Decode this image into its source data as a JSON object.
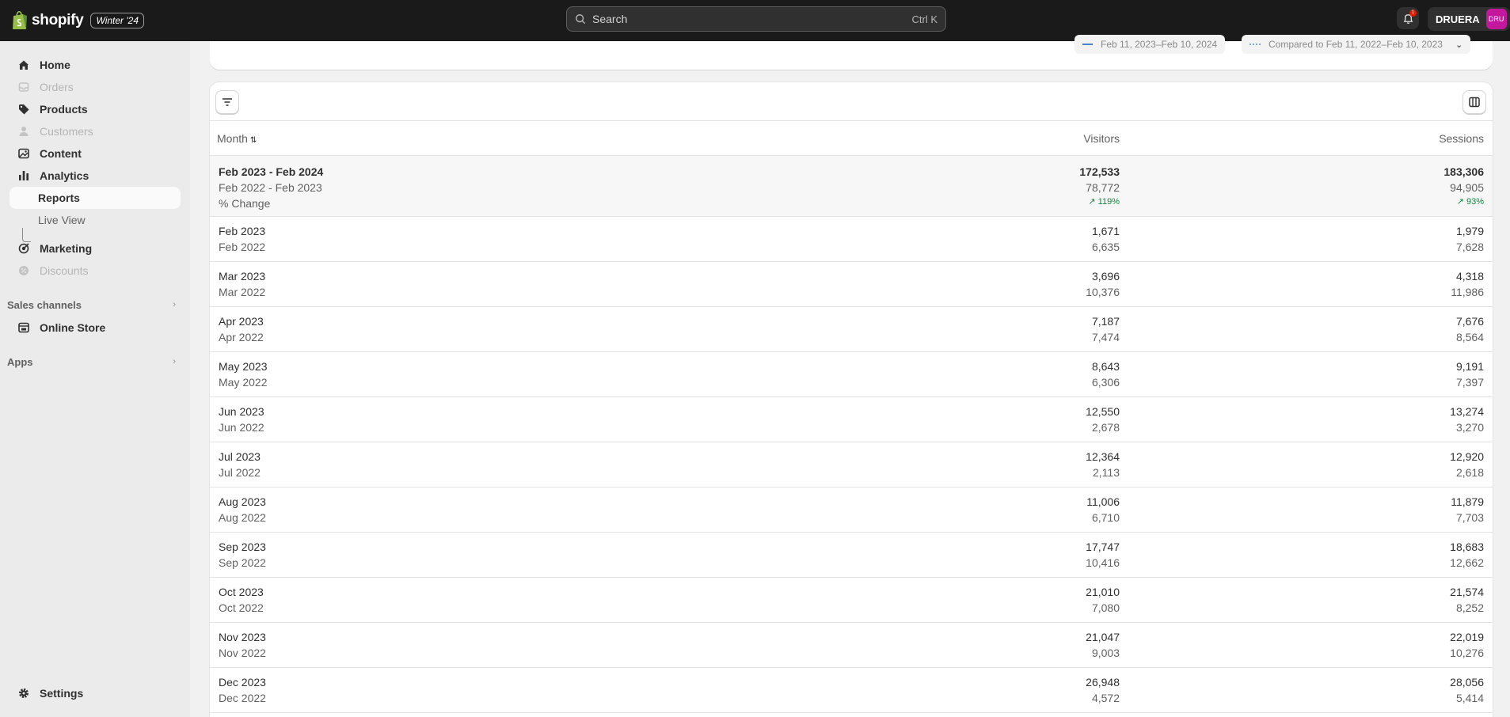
{
  "topbar": {
    "wordmark": "shopify",
    "release_badge": "Winter '24",
    "search_placeholder": "Search",
    "search_shortcut": "Ctrl K",
    "notification_count": "1",
    "account_name": "DRUERA",
    "avatar_initials": "DRU"
  },
  "sidebar": {
    "items": [
      {
        "label": "Home",
        "icon": "home-icon",
        "enabled": true
      },
      {
        "label": "Orders",
        "icon": "orders-icon",
        "enabled": false
      },
      {
        "label": "Products",
        "icon": "tag-icon",
        "enabled": true
      },
      {
        "label": "Customers",
        "icon": "person-icon",
        "enabled": false
      },
      {
        "label": "Content",
        "icon": "content-icon",
        "enabled": true
      },
      {
        "label": "Analytics",
        "icon": "bar-chart-icon",
        "enabled": true
      },
      {
        "label": "Reports",
        "sub": true,
        "active": true
      },
      {
        "label": "Live View",
        "sub": true
      },
      {
        "label": "Marketing",
        "icon": "target-icon",
        "enabled": true
      },
      {
        "label": "Discounts",
        "icon": "gear-badge-icon",
        "enabled": false
      }
    ],
    "sales_channels_label": "Sales channels",
    "online_store_label": "Online Store",
    "apps_label": "Apps",
    "settings_label": "Settings"
  },
  "date_bar": {
    "range_label": "Feb 11, 2023–Feb 10, 2024",
    "compare_label": "Compared to Feb 11, 2022–Feb 10, 2023"
  },
  "table": {
    "columns": {
      "month": "Month",
      "visitors": "Visitors",
      "sessions": "Sessions"
    },
    "total": {
      "period": "Feb 2023 - Feb 2024",
      "prev_period": "Feb 2022 - Feb 2023",
      "change_label": "% Change",
      "visitors": "172,533",
      "visitors_prev": "78,772",
      "visitors_change": "119%",
      "sessions": "183,306",
      "sessions_prev": "94,905",
      "sessions_change": "93%"
    },
    "rows": [
      {
        "month": "Feb 2023",
        "prev_month": "Feb 2022",
        "visitors": "1,671",
        "visitors_prev": "6,635",
        "sessions": "1,979",
        "sessions_prev": "7,628"
      },
      {
        "month": "Mar 2023",
        "prev_month": "Mar 2022",
        "visitors": "3,696",
        "visitors_prev": "10,376",
        "sessions": "4,318",
        "sessions_prev": "11,986"
      },
      {
        "month": "Apr 2023",
        "prev_month": "Apr 2022",
        "visitors": "7,187",
        "visitors_prev": "7,474",
        "sessions": "7,676",
        "sessions_prev": "8,564"
      },
      {
        "month": "May 2023",
        "prev_month": "May 2022",
        "visitors": "8,643",
        "visitors_prev": "6,306",
        "sessions": "9,191",
        "sessions_prev": "7,397"
      },
      {
        "month": "Jun 2023",
        "prev_month": "Jun 2022",
        "visitors": "12,550",
        "visitors_prev": "2,678",
        "sessions": "13,274",
        "sessions_prev": "3,270"
      },
      {
        "month": "Jul 2023",
        "prev_month": "Jul 2022",
        "visitors": "12,364",
        "visitors_prev": "2,113",
        "sessions": "12,920",
        "sessions_prev": "2,618"
      },
      {
        "month": "Aug 2023",
        "prev_month": "Aug 2022",
        "visitors": "11,006",
        "visitors_prev": "6,710",
        "sessions": "11,879",
        "sessions_prev": "7,703"
      },
      {
        "month": "Sep 2023",
        "prev_month": "Sep 2022",
        "visitors": "17,747",
        "visitors_prev": "10,416",
        "sessions": "18,683",
        "sessions_prev": "12,662"
      },
      {
        "month": "Oct 2023",
        "prev_month": "Oct 2022",
        "visitors": "21,010",
        "visitors_prev": "7,080",
        "sessions": "21,574",
        "sessions_prev": "8,252"
      },
      {
        "month": "Nov 2023",
        "prev_month": "Nov 2022",
        "visitors": "21,047",
        "visitors_prev": "9,003",
        "sessions": "22,019",
        "sessions_prev": "10,276"
      },
      {
        "month": "Dec 2023",
        "prev_month": "Dec 2022",
        "visitors": "26,948",
        "visitors_prev": "4,572",
        "sessions": "28,056",
        "sessions_prev": "5,414"
      }
    ]
  },
  "colors": {
    "topbar": "#1a1a1a",
    "sidebar": "#ebebeb",
    "positive": "#0a8a3b",
    "avatar": "#c3179e"
  }
}
